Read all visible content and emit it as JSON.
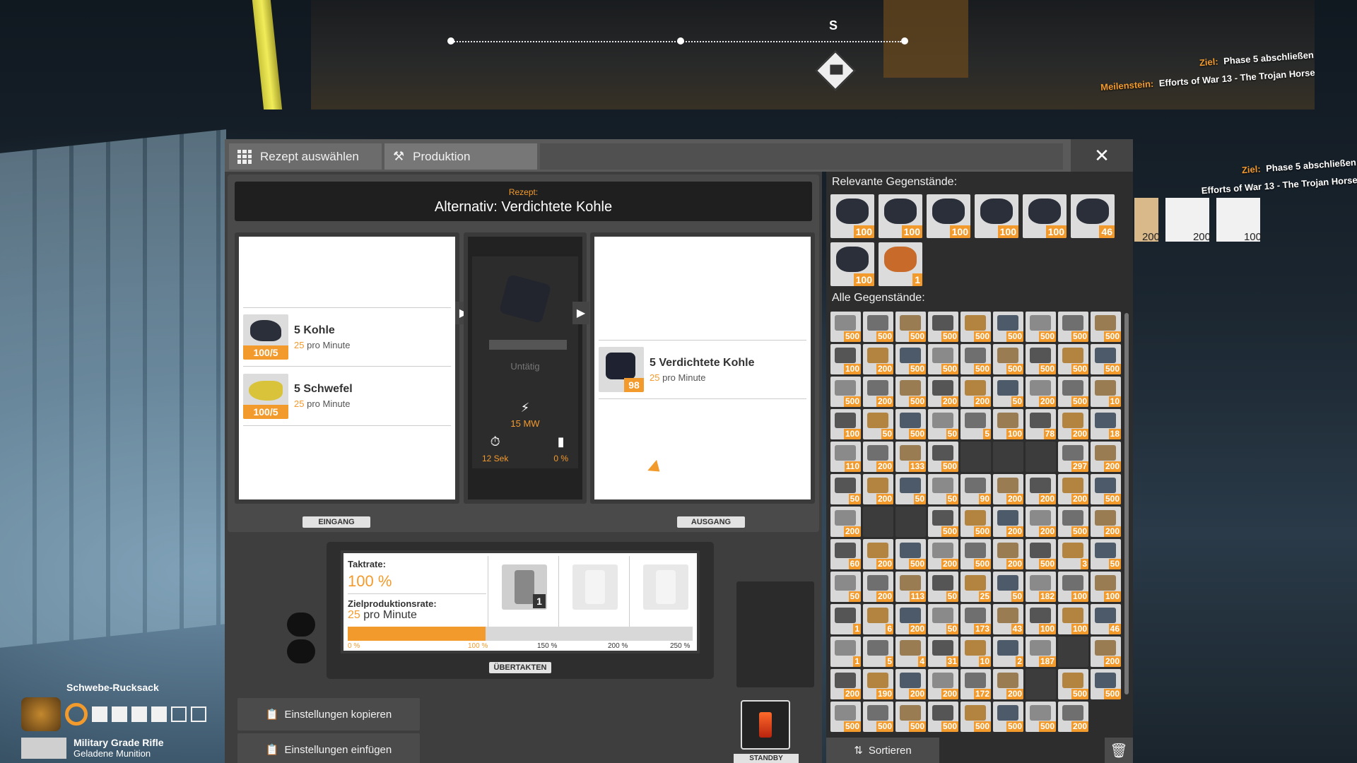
{
  "tabs": [
    {
      "label": "Rezept auswählen",
      "icon": "grid-icon"
    },
    {
      "label": "Produktion",
      "icon": "hammer-icon"
    }
  ],
  "compass": {
    "direction": "S"
  },
  "objectives": {
    "goal_key": "Ziel:",
    "goal_value": "Phase 5 abschließen",
    "milestone_key": "Meilenstein:",
    "milestone_value": "Efforts of War 13 - The Trojan Horse",
    "thumbs": [
      "",
      "200",
      "200",
      "100"
    ]
  },
  "recipe": {
    "label": "Rezept:",
    "name": "Alternativ: Verdichtete Kohle"
  },
  "inputs": [
    {
      "name": "5 Kohle",
      "rate_num": "25",
      "rate_unit": "pro Minute",
      "qty": "100/5",
      "color": "#2b2f3a"
    },
    {
      "name": "5 Schwefel",
      "rate_num": "25",
      "rate_unit": "pro Minute",
      "qty": "100/5",
      "color": "#d8c33a"
    }
  ],
  "output": {
    "name": "5 Verdichtete Kohle",
    "rate_num": "25",
    "rate_unit": "pro Minute",
    "qty": "98",
    "color": "#1f2230"
  },
  "machine": {
    "status": "Untätig",
    "power": "15 MW",
    "cycle": "12 Sek",
    "efficiency": "0 %"
  },
  "labels": {
    "input": "EINGANG",
    "output": "AUSGANG",
    "overclock": "ÜBERTAKTEN",
    "standby": "STANDBY"
  },
  "overclock": {
    "clock_label": "Taktrate:",
    "clock_value": "100 %",
    "target_label": "Zielproduktionsrate:",
    "target_num": "25",
    "target_unit": "pro Minute",
    "shard_count": "1",
    "fill_fraction": 0.4,
    "ticks": [
      "0 %",
      "100 %",
      "150 %",
      "200 %",
      "250 %"
    ]
  },
  "buttons": {
    "copy": "Einstellungen kopieren",
    "paste": "Einstellungen einfügen",
    "sort": "Sortieren"
  },
  "inventory": {
    "relevant_title": "Relevante Gegenstände:",
    "all_title": "Alle Gegenstände:",
    "relevant": [
      {
        "count": "100",
        "color": "#2b2f3a"
      },
      {
        "count": "100",
        "color": "#2b2f3a"
      },
      {
        "count": "100",
        "color": "#2b2f3a"
      },
      {
        "count": "100",
        "color": "#2b2f3a"
      },
      {
        "count": "100",
        "color": "#2b2f3a"
      },
      {
        "count": "46",
        "color": "#2b2f3a"
      },
      {
        "count": "100",
        "color": "#2b2f3a"
      },
      {
        "count": "1",
        "color": "#c86a2a"
      }
    ],
    "all": [
      "500",
      "500",
      "500",
      "500",
      "500",
      "500",
      "500",
      "500",
      "500",
      "100",
      "200",
      "500",
      "500",
      "500",
      "500",
      "500",
      "500",
      "500",
      "500",
      "200",
      "500",
      "200",
      "200",
      "50",
      "200",
      "500",
      "10",
      "100",
      "50",
      "500",
      "50",
      "5",
      "100",
      "78",
      "200",
      "18",
      "110",
      "200",
      "133",
      "500",
      "",
      "",
      "",
      "297",
      "200",
      "50",
      "200",
      "50",
      "50",
      "90",
      "200",
      "200",
      "200",
      "500",
      "200",
      "",
      "",
      "500",
      "500",
      "200",
      "200",
      "500",
      "200",
      "60",
      "200",
      "500",
      "200",
      "500",
      "200",
      "500",
      "3",
      "50",
      "50",
      "200",
      "113",
      "50",
      "25",
      "50",
      "182",
      "100",
      "100",
      "1",
      "6",
      "200",
      "50",
      "173",
      "43",
      "100",
      "100",
      "46",
      "1",
      "5",
      "4",
      "31",
      "10",
      "2",
      "187",
      "",
      "200",
      "200",
      "190",
      "200",
      "200",
      "172",
      "200",
      "",
      "500",
      "500",
      "500",
      "500",
      "500",
      "500",
      "500",
      "500",
      "500",
      "200"
    ]
  },
  "hud": {
    "jetpack": "Schwebe-Rucksack",
    "weapon": "Military Grade Rifle",
    "ammo": "Geladene Munition"
  }
}
